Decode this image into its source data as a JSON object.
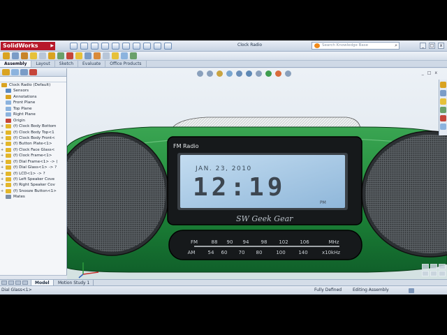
{
  "app": {
    "name": "SolidWorks",
    "document_title": "Clock Radio",
    "search_placeholder": "Search Knowledge Base"
  },
  "window_controls": [
    "_",
    "□",
    "x"
  ],
  "command_tabs": [
    {
      "label": "Assembly",
      "active": true
    },
    {
      "label": "Layout",
      "active": false
    },
    {
      "label": "Sketch",
      "active": false
    },
    {
      "label": "Evaluate",
      "active": false
    },
    {
      "label": "Office Products",
      "active": false
    }
  ],
  "feature_tree": [
    {
      "label": "Clock Radio  (Default)",
      "indent": 0,
      "icon": "assembly-icon",
      "color": "#d9a321"
    },
    {
      "label": "Sensors",
      "indent": 1,
      "icon": "sensors-icon",
      "color": "#5a8ac2"
    },
    {
      "label": "Annotations",
      "indent": 1,
      "icon": "annotations-icon",
      "color": "#d9a321"
    },
    {
      "label": "Front Plane",
      "indent": 1,
      "icon": "plane-icon",
      "color": "#8cb3de"
    },
    {
      "label": "Top Plane",
      "indent": 1,
      "icon": "plane-icon",
      "color": "#8cb3de"
    },
    {
      "label": "Right Plane",
      "indent": 1,
      "icon": "plane-icon",
      "color": "#8cb3de"
    },
    {
      "label": "Origin",
      "indent": 1,
      "icon": "origin-icon",
      "color": "#c5453a"
    },
    {
      "label": "(f) Clock Body Bottom",
      "indent": 1,
      "icon": "part-icon",
      "color": "#e3b62a",
      "expandable": true
    },
    {
      "label": "(f) Clock Body Top<1",
      "indent": 1,
      "icon": "part-icon",
      "color": "#e3b62a",
      "expandable": true
    },
    {
      "label": "(f) Clock Body Front<",
      "indent": 1,
      "icon": "part-icon",
      "color": "#e3b62a",
      "expandable": true
    },
    {
      "label": "(f) Button Plate<1>",
      "indent": 1,
      "icon": "part-icon",
      "color": "#e3b62a",
      "expandable": true
    },
    {
      "label": "(f) Clock Face Glass<",
      "indent": 1,
      "icon": "part-icon",
      "color": "#e3b62a",
      "expandable": true
    },
    {
      "label": "(f) Clock Frame<1>",
      "indent": 1,
      "icon": "part-icon",
      "color": "#e3b62a",
      "expandable": true
    },
    {
      "label": "(f) Dial Frame<1> -> (",
      "indent": 1,
      "icon": "part-icon",
      "color": "#e3b62a",
      "expandable": true
    },
    {
      "label": "(f) Dial Glass<1> -> ?",
      "indent": 1,
      "icon": "part-icon",
      "color": "#e3b62a",
      "expandable": true
    },
    {
      "label": "(f) LCD<1> -> ?",
      "indent": 1,
      "icon": "part-icon",
      "color": "#e3b62a",
      "expandable": true
    },
    {
      "label": "(f) Left Speaker Cove",
      "indent": 1,
      "icon": "part-icon",
      "color": "#e3b62a",
      "expandable": true
    },
    {
      "label": "(f) Right Speaker Cov",
      "indent": 1,
      "icon": "part-icon",
      "color": "#e3b62a",
      "expandable": true
    },
    {
      "label": "(f) Snooze Button<1>",
      "indent": 1,
      "icon": "part-icon",
      "color": "#e3b62a",
      "expandable": true
    },
    {
      "label": "Mates",
      "indent": 1,
      "icon": "mates-icon",
      "color": "#7d8fa6"
    }
  ],
  "radio": {
    "band_label": "FM Radio",
    "date": "JAN. 23, 2010",
    "time": "12:19",
    "ampm": "PM",
    "brand": "SW Geek Gear",
    "fm_label": "FM",
    "fm_values": [
      "88",
      "90",
      "94",
      "98",
      "102",
      "106"
    ],
    "fm_unit": "MHz",
    "am_label": "AM",
    "am_values": [
      "54",
      "60",
      "70",
      "80",
      "100",
      "140"
    ],
    "am_unit": "x10kHz",
    "body_color": "#1f8a3a",
    "lcd_color": "#a9c9e6"
  },
  "bottom_tabs": [
    {
      "label": "Model",
      "active": true
    },
    {
      "label": "Motion Study 1",
      "active": false
    }
  ],
  "status": {
    "selection": "Dial Glass<1>",
    "definition": "Fully Defined",
    "mode": "Editing Assembly"
  }
}
